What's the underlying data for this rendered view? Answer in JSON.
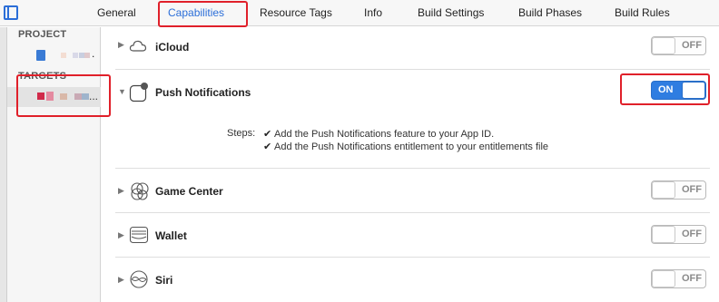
{
  "tabs": [
    {
      "label": "General",
      "active": false
    },
    {
      "label": "Capabilities",
      "active": true
    },
    {
      "label": "Resource Tags",
      "active": false
    },
    {
      "label": "Info",
      "active": false
    },
    {
      "label": "Build Settings",
      "active": false
    },
    {
      "label": "Build Phases",
      "active": false
    },
    {
      "label": "Build Rules",
      "active": false
    }
  ],
  "sidebar": {
    "project_header": "PROJECT",
    "targets_header": "TARGETS",
    "project_ellipsis": ".",
    "target_ellipsis": "..."
  },
  "capabilities": [
    {
      "label": "iCloud",
      "icon": "cloud-icon",
      "expanded": false,
      "toggle": "OFF"
    },
    {
      "label": "Push Notifications",
      "icon": "push-notification-icon",
      "expanded": true,
      "toggle": "ON"
    },
    {
      "label": "Game Center",
      "icon": "game-center-icon",
      "expanded": false,
      "toggle": "OFF"
    },
    {
      "label": "Wallet",
      "icon": "wallet-icon",
      "expanded": false,
      "toggle": "OFF"
    },
    {
      "label": "Siri",
      "icon": "siri-icon",
      "expanded": false,
      "toggle": "OFF"
    }
  ],
  "push_steps": {
    "label": "Steps:",
    "items": [
      "Add the Push Notifications feature to your App ID.",
      "Add the Push Notifications entitlement to your entitlements file"
    ]
  },
  "colors": {
    "accent": "#2b6ed8",
    "highlight": "#e0202a",
    "toggle_on": "#2f7de1"
  }
}
